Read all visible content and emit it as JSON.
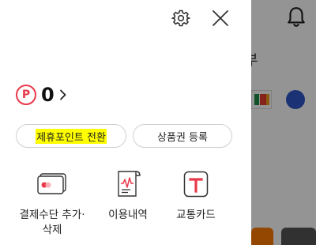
{
  "background": {
    "partial_text": "부"
  },
  "panel": {
    "points": {
      "icon_letter": "P",
      "value": "0"
    },
    "buttons": {
      "convert_label": "제휴포인트 전환",
      "register_label": "상품권 등록"
    },
    "menu": [
      {
        "label": "결제수단 추가·\n삭제",
        "icon": "card-icon"
      },
      {
        "label": "이용내역",
        "icon": "receipt-icon"
      },
      {
        "label": "교통카드",
        "icon": "transit-card-icon"
      }
    ]
  },
  "colors": {
    "accent": "#e8394a",
    "highlight": "#ffff00"
  }
}
